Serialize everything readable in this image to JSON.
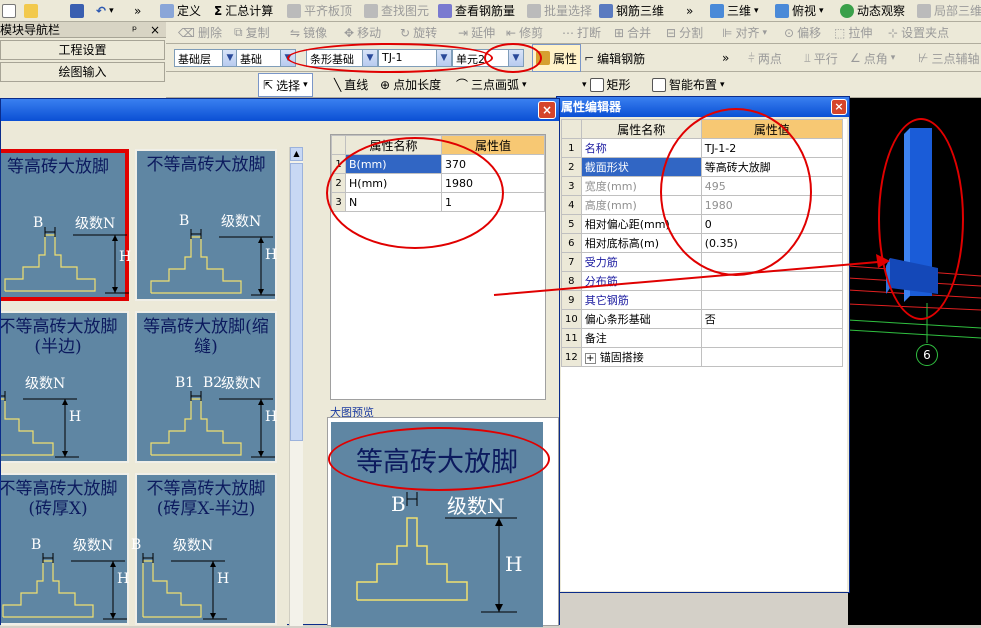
{
  "toolbar1": {
    "undo_arrow": "▾",
    "more": "»",
    "define": "定义",
    "sum_calc": "汇总计算",
    "flat_board": "平齐板顶",
    "find_element": "查找图元",
    "view_rebar_qty": "查看钢筋量",
    "batch_select": "批量选择",
    "rebar_3d": "钢筋三维",
    "more2": "»",
    "view_3d": "三维",
    "top_view": "俯视",
    "dynamic_view": "动态观察",
    "local_3d": "局部三维"
  },
  "nav_panel": {
    "title": "模块导航栏",
    "pin": "ᵖ",
    "close": "×",
    "project_settings": "工程设置",
    "drawing_input": "绘图输入"
  },
  "toolbar2": {
    "delete": "删除",
    "copy": "复制",
    "mirror": "镜像",
    "move": "移动",
    "rotate": "旋转",
    "extend": "延伸",
    "trim": "修剪",
    "break": "打断",
    "merge": "合并",
    "split": "分割",
    "align": "对齐",
    "offset": "偏移",
    "stretch": "拉伸",
    "set_point": "设置夹点"
  },
  "toolbar3": {
    "layer": "基础层",
    "category": "基础",
    "type": "条形基础",
    "element": "TJ-1",
    "unit": "单元2",
    "properties": "属性",
    "edit_rebar": "编辑钢筋",
    "more": "»",
    "two_points": "两点",
    "parallel": "平行",
    "point_angle": "点角",
    "three_point_aux": "三点辅轴"
  },
  "toolbar4": {
    "select": "选择",
    "line": "直线",
    "point_length": "点加长度",
    "arc": "三点画弧",
    "rect": "矩形",
    "smart_layout": "智能布置"
  },
  "shape_dialog": {
    "close": "×",
    "tiles": [
      {
        "title": "等高砖大放脚",
        "b": "B",
        "n": "级数N",
        "h": "H"
      },
      {
        "title": "不等高砖大放脚",
        "b": "B",
        "n": "级数N",
        "h": "H"
      },
      {
        "title": "不等高砖大放脚(半边)",
        "b": "B",
        "n": "级数N",
        "h": "H"
      },
      {
        "title": "等高砖大放脚(缩缝)",
        "b": "B1",
        "b2": "B2",
        "n": "级数N",
        "h": "H"
      },
      {
        "title": "不等高砖大放脚(砖厚X)",
        "b": "B",
        "n": "级数N",
        "h": "H"
      },
      {
        "title": "不等高砖大放脚(砖厚X-半边)",
        "b": "B",
        "n": "级数N",
        "h": "H"
      }
    ],
    "param_table": {
      "headers": [
        "属性名称",
        "属性值"
      ],
      "rows": [
        {
          "no": "1",
          "name": "B(mm)",
          "value": "370"
        },
        {
          "no": "2",
          "name": "H(mm)",
          "value": "1980"
        },
        {
          "no": "3",
          "name": "N",
          "value": "1"
        }
      ]
    },
    "preview_label": "大图预览",
    "preview": {
      "title": "等高砖大放脚",
      "b": "B",
      "n": "级数N",
      "h": "H"
    }
  },
  "prop_editor": {
    "title": "属性编辑器",
    "close": "×",
    "headers": [
      "属性名称",
      "属性值"
    ],
    "rows": [
      {
        "no": "1",
        "name": "名称",
        "value": "TJ-1-2"
      },
      {
        "no": "2",
        "name": "截面形状",
        "value": "等高砖大放脚"
      },
      {
        "no": "3",
        "name": "宽度(mm)",
        "value": "495"
      },
      {
        "no": "4",
        "name": "高度(mm)",
        "value": "1980"
      },
      {
        "no": "5",
        "name": "相对偏心距(mm)",
        "value": "0"
      },
      {
        "no": "6",
        "name": "相对底标高(m)",
        "value": "(0.35)"
      },
      {
        "no": "7",
        "name": "受力筋",
        "value": ""
      },
      {
        "no": "8",
        "name": "分布筋",
        "value": ""
      },
      {
        "no": "9",
        "name": "其它钢筋",
        "value": ""
      },
      {
        "no": "10",
        "name": "偏心条形基础",
        "value": "否"
      },
      {
        "no": "11",
        "name": "备注",
        "value": ""
      },
      {
        "no": "12",
        "name": "锚固搭接",
        "value": ""
      }
    ],
    "expand": "+"
  },
  "viewport": {
    "axis_label": "6"
  },
  "colors": {
    "highlight": "#e00000",
    "dialog_title": "#0a4fd4",
    "tile_bg": "#5f86a3",
    "value_header": "#f7c873"
  }
}
